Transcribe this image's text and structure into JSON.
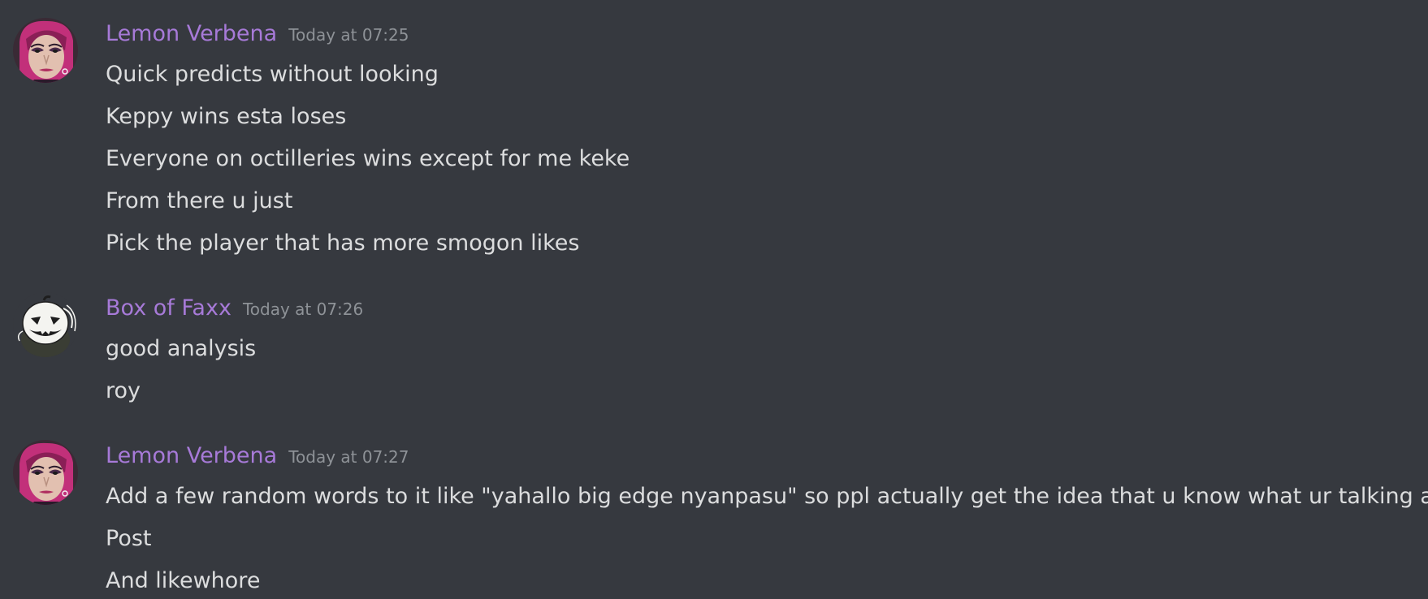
{
  "messages": [
    {
      "author": "Lemon Verbena",
      "timestamp": "Today at 07:25",
      "avatar_icon": "drag-queen-portrait-avatar",
      "lines": [
        "Quick predicts without looking",
        "Keppy wins esta loses",
        "Everyone on octilleries wins except for me keke",
        "From there u just",
        "Pick the player that has more smogon likes"
      ]
    },
    {
      "author": "Box of Faxx",
      "timestamp": "Today at 07:26",
      "avatar_icon": "jack-o-lantern-avatar",
      "lines": [
        "good analysis",
        "roy"
      ]
    },
    {
      "author": "Lemon Verbena",
      "timestamp": "Today at 07:27",
      "avatar_icon": "drag-queen-portrait-avatar",
      "lines": [
        "Add a few random words to it like \"yahallo big edge nyanpasu\" so ppl actually get the idea that u know what ur talking abt",
        "Post",
        "And likewhore"
      ]
    }
  ],
  "colors": {
    "background": "#36393f",
    "username": "#a77ad8",
    "message_text": "#dcddde",
    "timestamp": "#8e9297"
  }
}
